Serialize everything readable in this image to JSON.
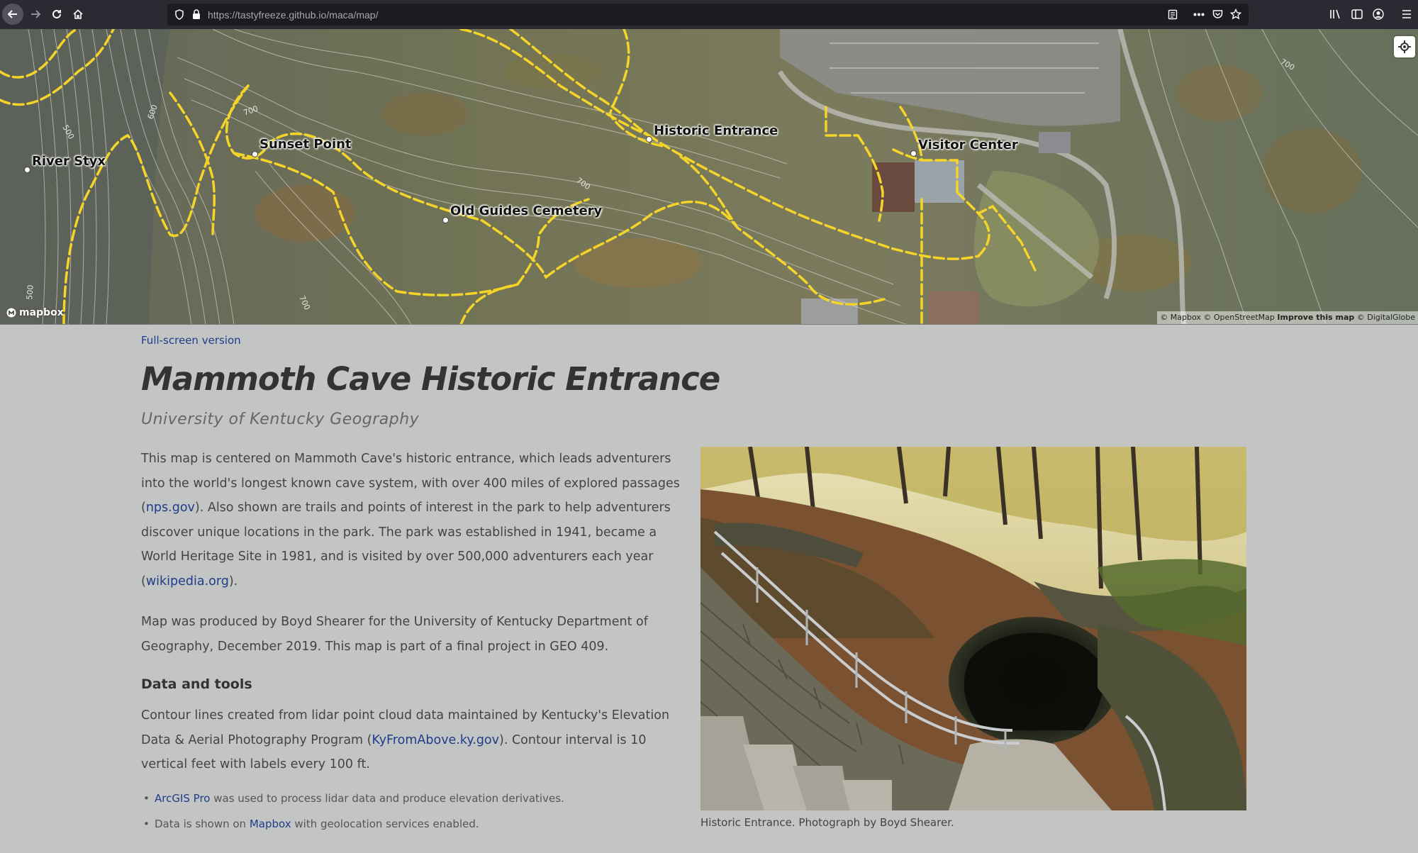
{
  "browser": {
    "url_host": "https://tastyfreeze.github.io",
    "url_path": "/maca/map/"
  },
  "map": {
    "pois": [
      {
        "label": "River Styx"
      },
      {
        "label": "Sunset Point"
      },
      {
        "label": "Historic Entrance"
      },
      {
        "label": "Visitor Center"
      },
      {
        "label": "Old Guides Cemetery"
      }
    ],
    "contour_labels": [
      "600",
      "500",
      "700",
      "700",
      "500",
      "700",
      "700"
    ],
    "logo": "mapbox",
    "attribution": {
      "mapbox": "© Mapbox",
      "osm": "© OpenStreetMap",
      "improve": "Improve this map",
      "globe": "© DigitalGlobe"
    },
    "colors": {
      "trail": "#f5d42a",
      "aerial_forest": "#6d7158",
      "contour": "#e8e8e8"
    }
  },
  "content": {
    "fullscreen_link": "Full-screen version",
    "title": "Mammoth Cave Historic Entrance",
    "subtitle": "University of Kentucky Geography",
    "p1_a": "This map is centered on Mammoth Cave's historic entrance, which leads adventurers into the world's longest known cave system, with over 400 miles of explored passages (",
    "p1_link1": "nps.gov",
    "p1_b": "). Also shown are trails and points of interest in the park to help adventurers discover unique locations in the park. The park was established in 1941, became a World Heritage Site in 1981, and is visited by over 500,000 adventurers each year (",
    "p1_link2": "wikipedia.org",
    "p1_c": ").",
    "p2": "Map was produced by Boyd Shearer for the University of Kentucky Department of Geography, December 2019. This map is part of a final project in GEO 409.",
    "h_data": "Data and tools",
    "p3_a": "Contour lines created from lidar point cloud data maintained by Kentucky's Elevation Data & Aerial Photography Program (",
    "p3_link": "KyFromAbove.ky.gov",
    "p3_b": "). Contour interval is 10 vertical feet with labels every 100 ft.",
    "li1_link": "ArcGIS Pro",
    "li1_text": " was used to process lidar data and produce elevation derivatives.",
    "li2_a": "Data is shown on ",
    "li2_link": "Mapbox",
    "li2_b": " with geolocation services enabled.",
    "caption": "Historic Entrance. Photograph by Boyd Shearer."
  }
}
